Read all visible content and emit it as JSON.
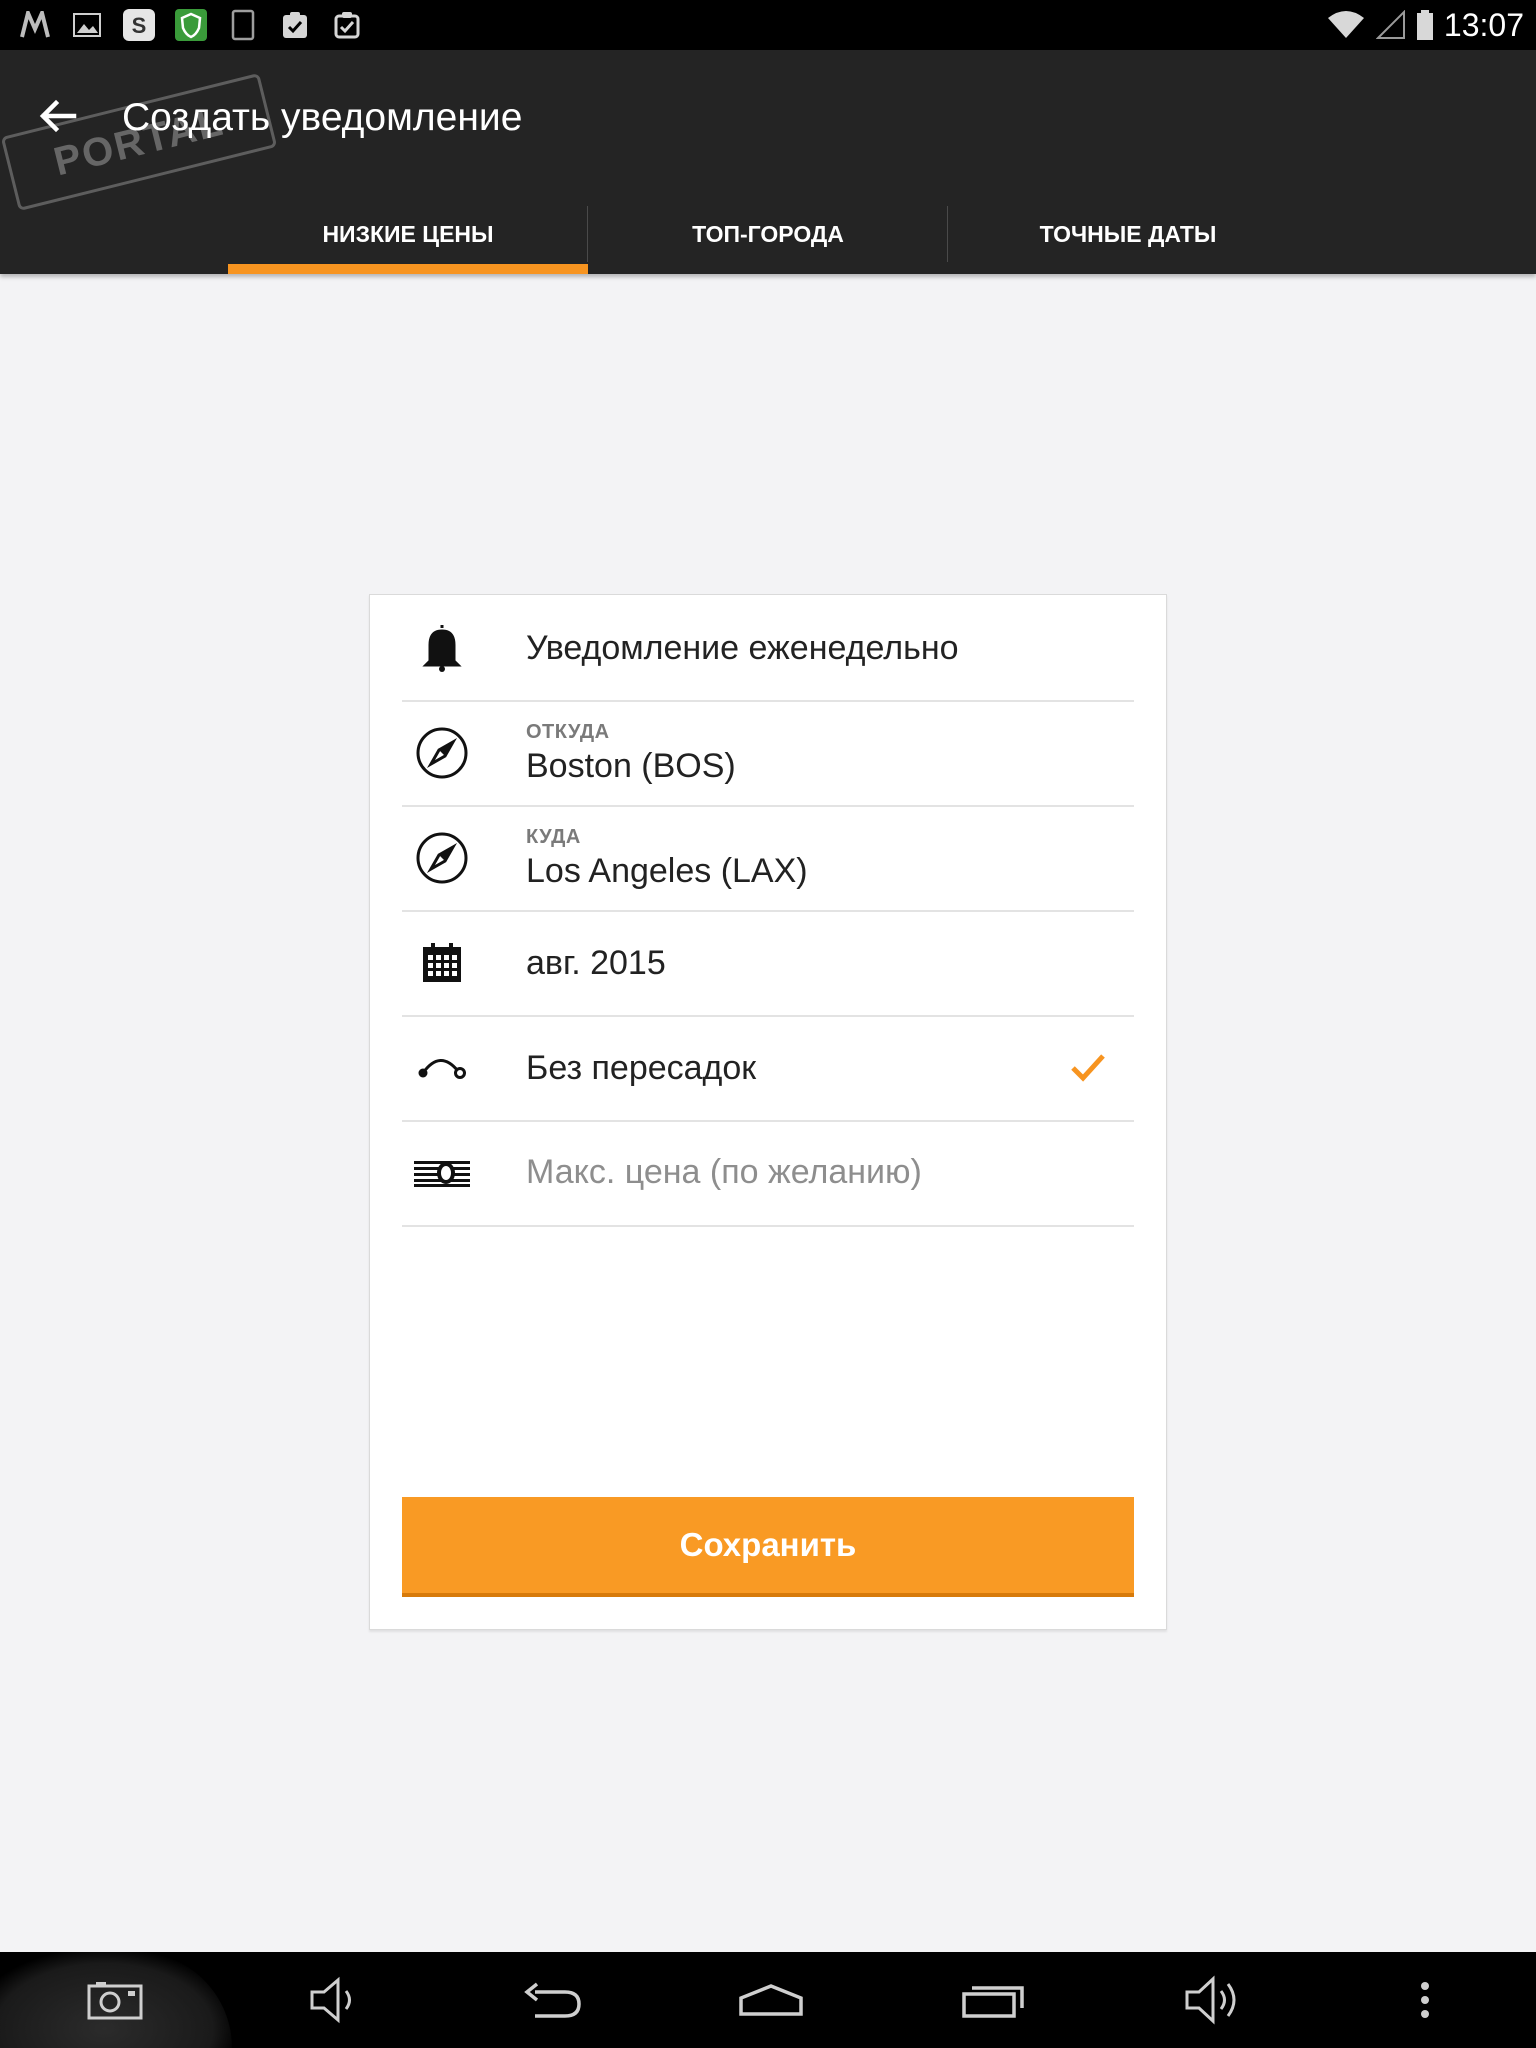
{
  "status_bar": {
    "time": "13:07",
    "left_icons": [
      "m-app-icon",
      "image-icon",
      "skype-icon",
      "shield-app-icon",
      "tablet-icon",
      "clipboard-check-icon",
      "clipboard-check-icon"
    ]
  },
  "app_bar": {
    "title": "Создать уведомление",
    "watermark": "PORTAL"
  },
  "tabs": [
    {
      "label": "НИЗКИЕ ЦЕНЫ",
      "active": true
    },
    {
      "label": "ТОП-ГОРОДА",
      "active": false
    },
    {
      "label": "ТОЧНЫЕ ДАТЫ",
      "active": false
    }
  ],
  "form": {
    "frequency": {
      "label": "Уведомление еженедельно",
      "icon": "bell-icon"
    },
    "origin": {
      "caption": "ОТКУДА",
      "value": "Boston (BOS)",
      "icon": "compass-icon"
    },
    "destination": {
      "caption": "КУДА",
      "value": "Los Angeles (LAX)",
      "icon": "compass-icon"
    },
    "date": {
      "value": "авг. 2015",
      "icon": "calendar-icon"
    },
    "direct": {
      "label": "Без пересадок",
      "checked": true,
      "icon": "route-icon"
    },
    "max_price": {
      "placeholder": "Макс. цена (по желанию)",
      "icon": "money-icon"
    },
    "save_label": "Сохранить"
  },
  "colors": {
    "accent": "#f99a24",
    "app_bar": "#242424",
    "background": "#f3f3f5"
  },
  "nav_bar": [
    "screenshot-icon",
    "volume-down-icon",
    "back-icon",
    "home-icon",
    "recents-icon",
    "volume-up-icon",
    "overflow-icon"
  ]
}
